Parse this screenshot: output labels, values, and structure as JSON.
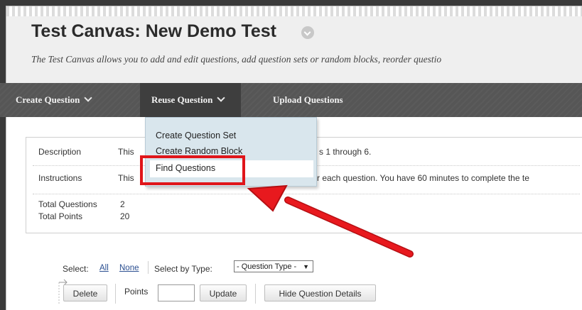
{
  "page": {
    "title": "Test Canvas: New Demo Test",
    "subtitle": "The Test Canvas allows you to add and edit questions, add question sets or random blocks, reorder questio"
  },
  "menubar": {
    "create_question": "Create Question",
    "reuse_question": "Reuse Question",
    "upload_questions": "Upload Questions"
  },
  "dropdown": {
    "items": [
      "Create Question Set",
      "Create Random Block",
      "Find Questions"
    ]
  },
  "details": {
    "description_label": "Description",
    "description_start": "This",
    "description_end": "s 1 through 6.",
    "instructions_label": "Instructions",
    "instructions_start": "This",
    "instructions_end": "r each question. You have 60 minutes to complete the te",
    "total_questions_label": "Total Questions",
    "total_questions_value": "2",
    "total_points_label": "Total Points",
    "total_points_value": "20"
  },
  "toolbar": {
    "select_label": "Select:",
    "all": "All",
    "none": "None",
    "select_by_type": "Select by Type:",
    "question_type": "- Question Type -",
    "delete": "Delete",
    "points": "Points",
    "points_value": "",
    "update": "Update",
    "hide_details": "Hide Question Details"
  },
  "colors": {
    "menubar": "#565656",
    "dropdown": "#d9e6ed",
    "highlight": "#e0151a",
    "link": "#2a4e90"
  }
}
